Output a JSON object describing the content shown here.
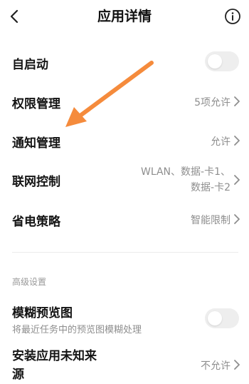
{
  "header": {
    "title": "应用详情",
    "back_icon": "chevron-left-icon",
    "info_icon": "info-circle-icon"
  },
  "rows": {
    "autostart": {
      "label": "自启动",
      "toggle_on": false
    },
    "permissions": {
      "label": "权限管理",
      "value": "5项允许"
    },
    "notifications": {
      "label": "通知管理",
      "value": "允许"
    },
    "network": {
      "label": "联网控制",
      "value_line1": "WLAN、数据-卡1、",
      "value_line2": "数据-卡2"
    },
    "battery": {
      "label": "省电策略",
      "value": "智能限制"
    }
  },
  "advanced": {
    "section_title": "高级设置",
    "blur_preview": {
      "label": "模糊预览图",
      "subtitle": "将最近任务中的预览图模糊处理",
      "toggle_on": false
    },
    "unknown_sources": {
      "label_line1": "安装应用未知来",
      "label_line2": "源",
      "value": "不允许"
    }
  },
  "annotation": {
    "arrow_color": "#F58B3C"
  },
  "colors": {
    "secondary_text": "#8E8E8E",
    "toggle_off": "#EEEEEE"
  }
}
